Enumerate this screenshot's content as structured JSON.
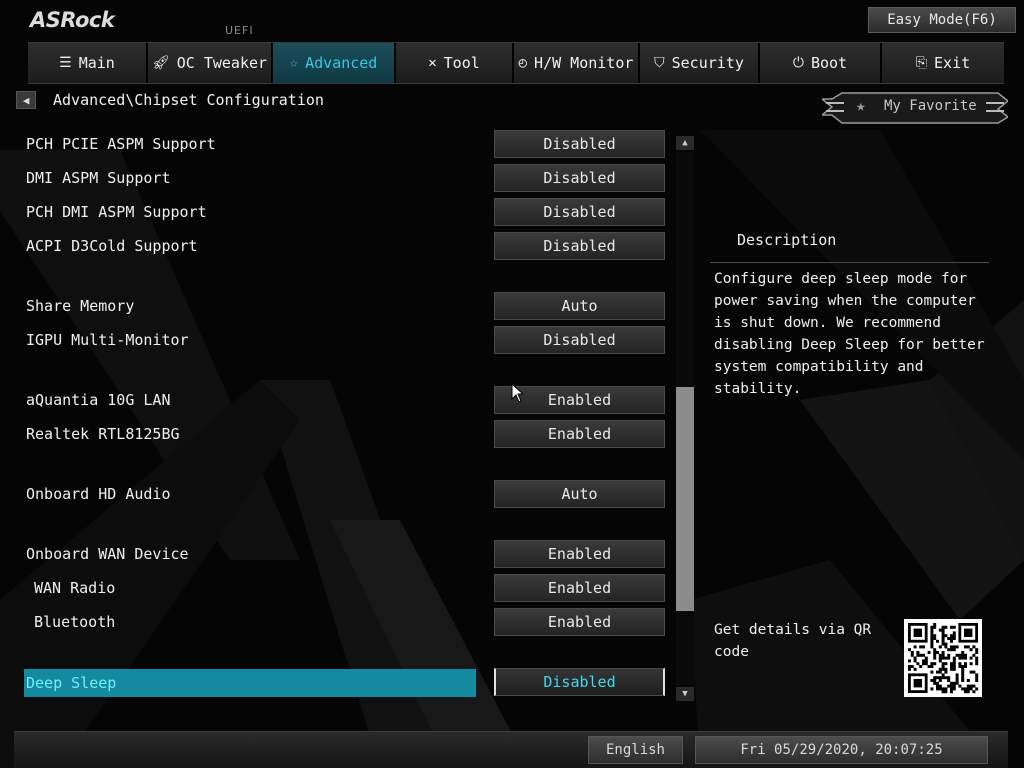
{
  "header": {
    "logo": "ASRock",
    "uefi": "UEFI",
    "easy_mode": "Easy Mode(F6)"
  },
  "tabs": [
    {
      "label": "Main",
      "icon": "list-icon",
      "active": false
    },
    {
      "label": "OC Tweaker",
      "icon": "rocket-icon",
      "active": false
    },
    {
      "label": "Advanced",
      "icon": "star-icon",
      "active": true
    },
    {
      "label": "Tool",
      "icon": "tools-icon",
      "active": false
    },
    {
      "label": "H/W Monitor",
      "icon": "monitor-icon",
      "active": false
    },
    {
      "label": "Security",
      "icon": "shield-icon",
      "active": false
    },
    {
      "label": "Boot",
      "icon": "power-icon",
      "active": false
    },
    {
      "label": "Exit",
      "icon": "exit-icon",
      "active": false
    }
  ],
  "breadcrumb": "Advanced\\Chipset Configuration",
  "favorite": {
    "label": "My Favorite"
  },
  "settings": [
    {
      "label": "PCH PCIE ASPM Support",
      "value": "Disabled"
    },
    {
      "label": "DMI ASPM Support",
      "value": "Disabled"
    },
    {
      "label": "PCH DMI ASPM Support",
      "value": "Disabled"
    },
    {
      "label": "ACPI D3Cold Support",
      "value": "Disabled"
    },
    {
      "label": "Share Memory",
      "value": "Auto"
    },
    {
      "label": "IGPU Multi-Monitor",
      "value": "Disabled"
    },
    {
      "label": "aQuantia 10G LAN",
      "value": "Enabled"
    },
    {
      "label": "Realtek RTL8125BG",
      "value": "Enabled"
    },
    {
      "label": "Onboard HD Audio",
      "value": "Auto"
    },
    {
      "label": "Onboard WAN Device",
      "value": "Enabled"
    },
    {
      "label": "WAN Radio",
      "value": "Enabled"
    },
    {
      "label": "Bluetooth",
      "value": "Enabled"
    },
    {
      "label": "Deep Sleep",
      "value": "Disabled"
    }
  ],
  "scroll": {
    "thumb_start": 0.44,
    "thumb_end": 0.86
  },
  "description": {
    "title": "Description",
    "text": "Configure deep sleep mode for power saving when the computer is shut down. We recommend disabling Deep Sleep for better system compatibility and stability.",
    "qr_text": "Get details via QR code"
  },
  "status": {
    "language": "English",
    "datetime": "Fri 05/29/2020, 20:07:25"
  },
  "colors": {
    "accent": "#35c8e0",
    "selected_row": "#138aa0"
  }
}
